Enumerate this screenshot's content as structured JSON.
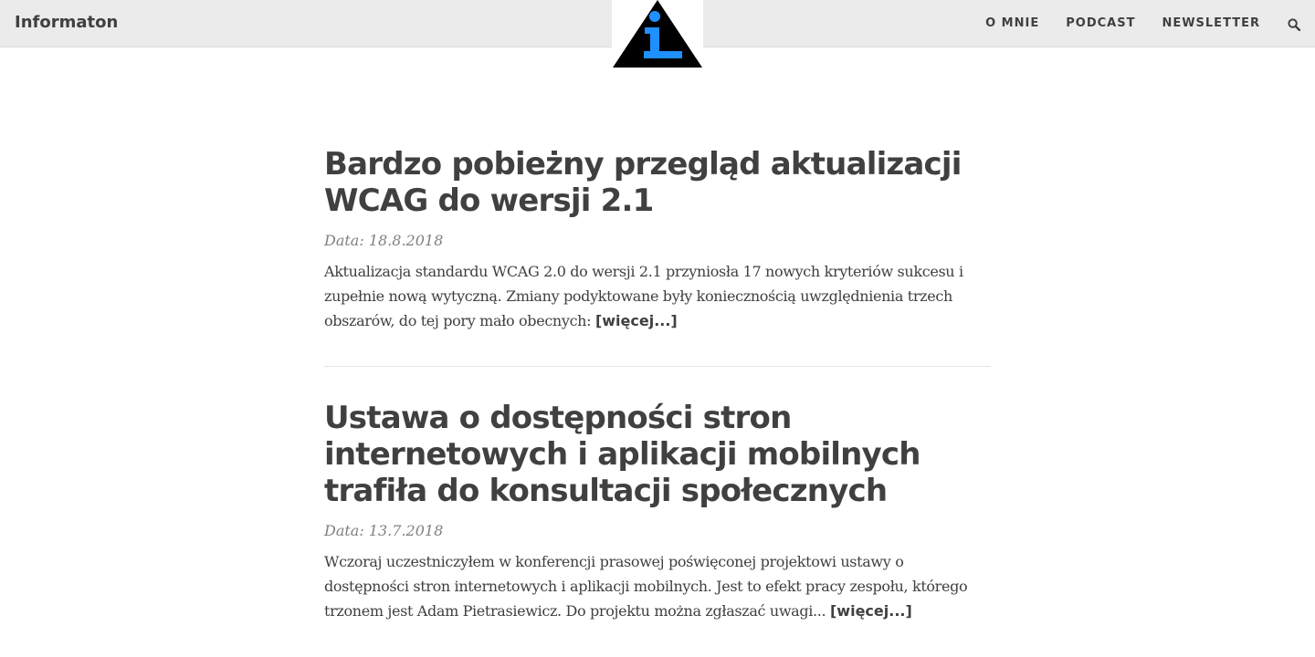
{
  "navbar": {
    "brand": "Informaton",
    "links": [
      "O MNIE",
      "PODCAST",
      "NEWSLETTER"
    ]
  },
  "posts": [
    {
      "title": "Bardzo pobieżny przegląd aktualizacji WCAG do wersji 2.1",
      "meta": "Data: 18.8.2018",
      "excerpt": "Aktualizacja standardu WCAG 2.0 do wersji 2.1 przyniosła 17 nowych kryteriów sukcesu i zupełnie nową wytyczną. Zmiany podyktowane były koniecznością uwzględnienia trzech obszarów, do tej pory mało obecnych:",
      "read_more": "[więcej...]"
    },
    {
      "title": "Ustawa o dostępności stron internetowych i aplikacji mobilnych trafiła do konsultacji społecznych",
      "meta": "Data: 13.7.2018",
      "excerpt": "Wczoraj uczestniczyłem w konferencji prasowej poświęconej projektowi ustawy o dostępności stron internetowych i aplikacji mobilnych. Jest to efekt pracy zespołu, którego trzonem jest Adam Pietrasiewicz. Do projektu można zgłaszać uwagi...",
      "read_more": "[więcej...]"
    }
  ],
  "icons": {
    "logo": "info-triangle-icon",
    "search": "search-icon"
  },
  "colors": {
    "navbar_bg": "#ebebeb",
    "text": "#404040",
    "meta": "#808080",
    "logo_accent": "#1e90ff"
  }
}
